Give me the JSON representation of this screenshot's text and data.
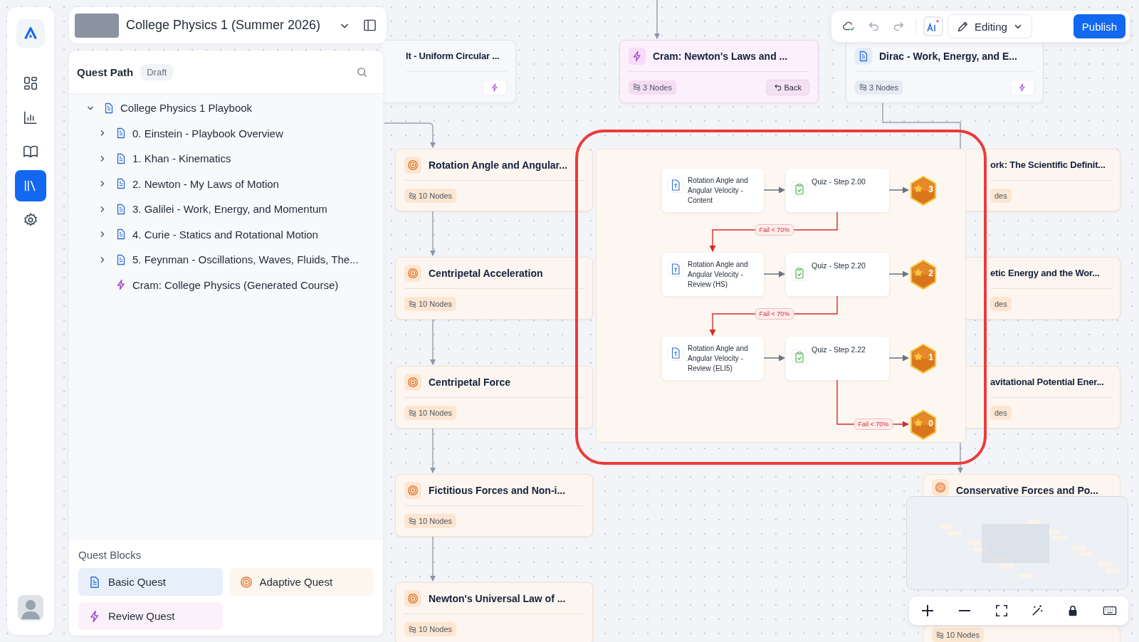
{
  "rail": [
    {
      "selected": false
    },
    {
      "selected": false
    },
    {
      "selected": false
    },
    {
      "selected": true
    },
    {
      "selected": false
    }
  ],
  "course": {
    "title": "College Physics 1 (Summer 2026)"
  },
  "quest_path": {
    "title": "Quest Path",
    "badge": "Draft",
    "tree": {
      "label": "College Physics 1 Playbook",
      "kind": "basic",
      "expanded": true,
      "children": [
        {
          "label": "0. Einstein - Playbook Overview",
          "kind": "basic",
          "expanded": false
        },
        {
          "label": "1. Khan - Kinematics",
          "kind": "basic",
          "expanded": false
        },
        {
          "label": "2. Newton - My Laws of Motion",
          "kind": "basic",
          "expanded": false
        },
        {
          "label": "3. Galilei - Work, Energy, and Momentum",
          "kind": "basic",
          "expanded": false
        },
        {
          "label": "4. Curie - Statics and Rotational Motion",
          "kind": "basic",
          "expanded": false
        },
        {
          "label": "5. Feynman - Oscillations, Waves, Fluids, The...",
          "kind": "basic",
          "expanded": false
        },
        {
          "label": "Cram: College Physics (Generated Course)",
          "kind": "review"
        }
      ]
    }
  },
  "quest_blocks": {
    "title": "Quest Blocks",
    "items": [
      {
        "label": "Basic Quest",
        "kind": "basic"
      },
      {
        "label": "Adaptive Quest",
        "kind": "adaptive"
      },
      {
        "label": "Review Quest",
        "kind": "review"
      }
    ]
  },
  "toolbar": {
    "mode": "Editing",
    "publish": "Publish"
  },
  "cards": [
    {
      "kind": "basic",
      "clipped": true,
      "title": "lt - Uniform Circular ...",
      "generate_button": true
    },
    {
      "kind": "review",
      "clipped": false,
      "title": "Cram: Newton's Laws and ...",
      "nodes": "3 Nodes",
      "action": "Back"
    },
    {
      "kind": "basic",
      "clipped": false,
      "title": "Dirac - Work, Energy, and E...",
      "nodes": "3 Nodes",
      "generate_button": true
    },
    {
      "kind": "adaptive",
      "clipped": false,
      "title": "Rotation Angle and Angular...",
      "nodes": "10 Nodes"
    },
    {
      "kind": "adaptive",
      "clipped": false,
      "title": "Centripetal Acceleration",
      "nodes": "10 Nodes"
    },
    {
      "kind": "adaptive",
      "clipped": false,
      "title": "Centripetal Force",
      "nodes": "10 Nodes"
    },
    {
      "kind": "adaptive",
      "clipped": false,
      "title": "Fictitious Forces and Non-i...",
      "nodes": "10 Nodes"
    },
    {
      "kind": "adaptive",
      "clipped": false,
      "title": "Newton's Universal Law of ...",
      "nodes": "10 Nodes"
    },
    {
      "kind": "adaptive",
      "clipped": true,
      "title": "ork: The Scientific Definit...",
      "nodes": "des"
    },
    {
      "kind": "adaptive",
      "clipped": true,
      "title": "etic Energy and the Wor...",
      "nodes": "des"
    },
    {
      "kind": "adaptive",
      "clipped": true,
      "title": "avitational Potential Ener...",
      "nodes": "des"
    },
    {
      "kind": "adaptive",
      "clipped": false,
      "title": "Conservative Forces and Po..."
    },
    {
      "kind": "adaptive",
      "clipped": false,
      "nodes": "10 Nodes"
    }
  ],
  "flow": {
    "rows": [
      {
        "content": "Rotation Angle and Angular Velocity - Content",
        "quiz": "Quiz - Step 2.00",
        "badge": "3"
      },
      {
        "content": "Rotation Angle and Angular Velocity - Review (HS)",
        "quiz": "Quiz - Step 2.20",
        "badge": "2"
      },
      {
        "content": "Rotation Angle and Angular Velocity - Review (ELI5)",
        "quiz": "Quiz - Step 2.22",
        "badge": "1"
      }
    ],
    "fail_labels": [
      "Fail < 70%",
      "Fail < 70%",
      "Fail < 70%"
    ],
    "final_badge": "0"
  }
}
